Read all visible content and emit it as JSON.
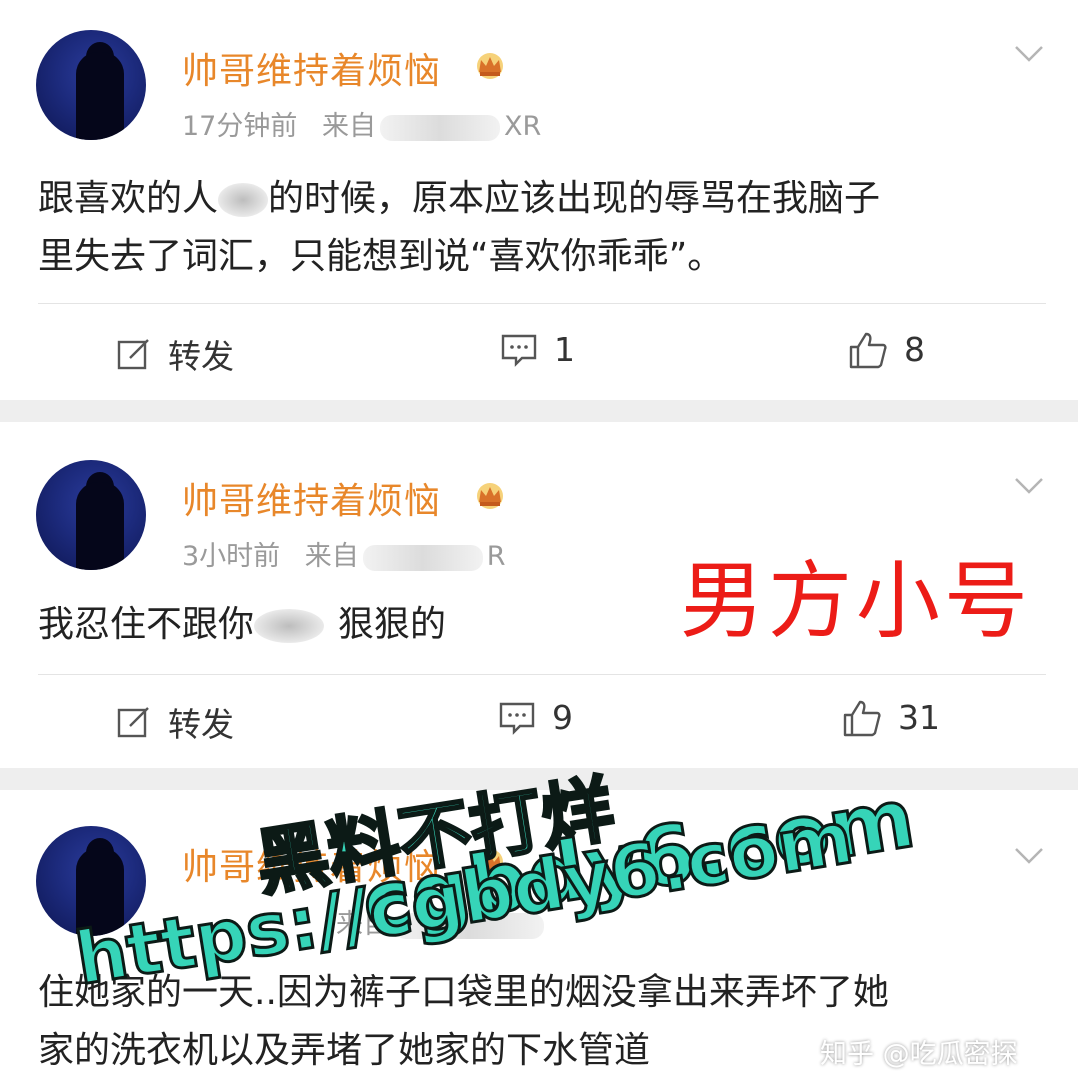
{
  "posts": [
    {
      "username": "帅哥维持着烦恼",
      "time": "17分钟前",
      "source_prefix": "来自",
      "source_tail": "XR",
      "text_line1_a": "跟喜欢的人",
      "text_line1_b": "的时候，原本应该出现的辱骂在我脑子",
      "text_line2": "里失去了词汇，只能想到说“喜欢你乖乖”。",
      "repost_label": "转发",
      "comments": "1",
      "likes": "8"
    },
    {
      "username": "帅哥维持着烦恼",
      "time": "3小时前",
      "source_prefix": "来自",
      "source_tail": "R",
      "text_a": "我忍住不跟你",
      "text_b": "狠狠的",
      "repost_label": "转发",
      "comments": "9",
      "likes": "31"
    },
    {
      "username": "帅哥维持着烦恼",
      "time_fragment": "",
      "source_prefix": "来自",
      "text_line1": "住她家的一天..因为裤子口袋里的烟没拿出来弄坏了她",
      "text_line2": "家的洗衣机以及弄堵了她家的下水管道"
    }
  ],
  "annotation": "男方小号",
  "watermark": {
    "line1": "黑料不打烊",
    "line2": "cgbdy6.com",
    "line3": "https://cgbdy6.com"
  },
  "zhihu_credit": "知乎 @吃瓜密探",
  "colors": {
    "username": "#e8872a",
    "annotation": "#ec1c17",
    "watermark": "#36d4b8"
  }
}
